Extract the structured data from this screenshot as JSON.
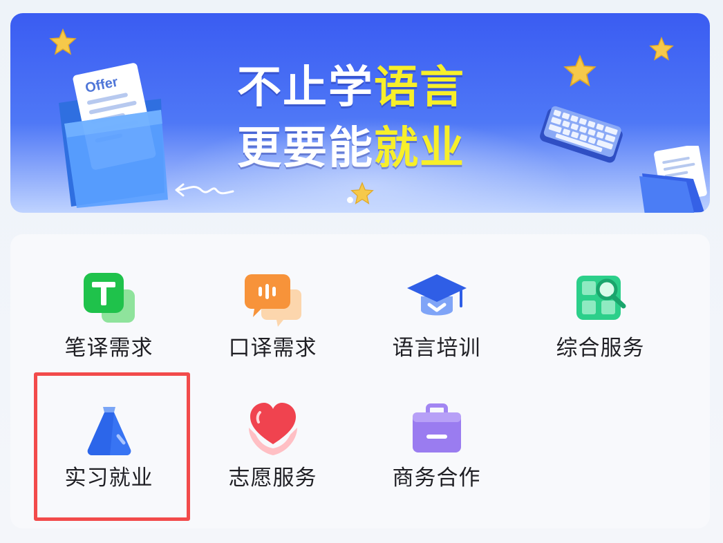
{
  "banner": {
    "line1_white": "不止学",
    "line1_yellow": "语言",
    "line2_white": "更要能",
    "line2_yellow": "就业",
    "offer_text": "Offer",
    "colors": {
      "background": "#3a5cf2",
      "highlight_text": "#f7ef2a"
    }
  },
  "services": {
    "row1": [
      {
        "label": "笔译需求",
        "icon": "written-translation-icon"
      },
      {
        "label": "口译需求",
        "icon": "interpretation-icon"
      },
      {
        "label": "语言培训",
        "icon": "graduation-cap-icon"
      },
      {
        "label": "综合服务",
        "icon": "search-grid-icon"
      }
    ],
    "row2": [
      {
        "label": "实习就业",
        "icon": "internship-bag-icon",
        "highlighted": true
      },
      {
        "label": "志愿服务",
        "icon": "heart-hands-icon"
      },
      {
        "label": "商务合作",
        "icon": "briefcase-icon"
      }
    ]
  },
  "highlight_color": "#f24b4b"
}
